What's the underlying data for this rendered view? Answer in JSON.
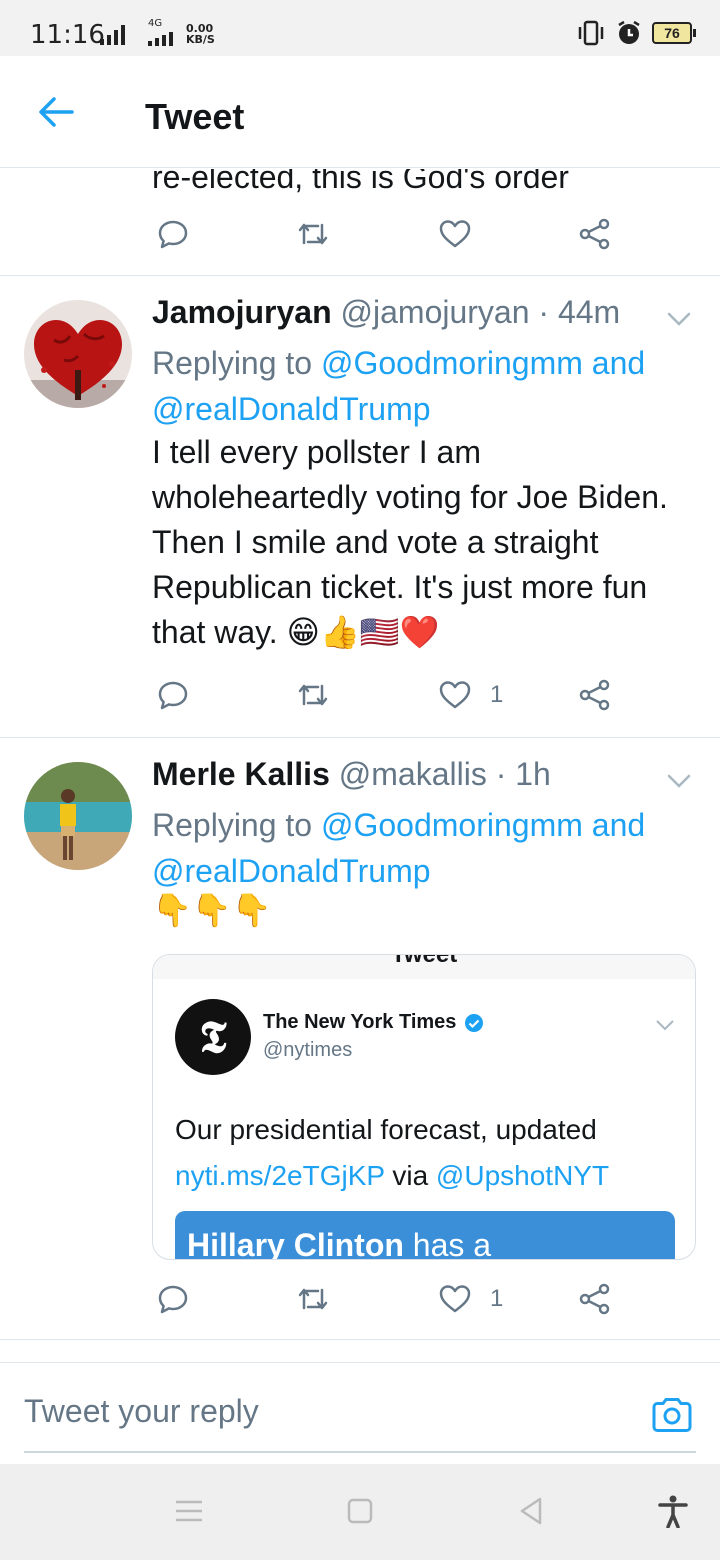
{
  "status_bar": {
    "time": "11:16",
    "network": "4G",
    "speed_value": "0.00",
    "speed_unit": "KB/S",
    "battery": "76"
  },
  "header": {
    "title": "Tweet",
    "back_icon": "arrow-left-icon"
  },
  "previous_tweet": {
    "partial_text": "re-elected, this is God's order",
    "actions": {
      "reply": "",
      "retweet": "",
      "like": "",
      "share": ""
    }
  },
  "tweets": [
    {
      "name": "Jamojuryan",
      "handle": "@jamojuryan",
      "time": "44m",
      "separator": "·",
      "replying_prefix": "Replying to",
      "replying_user1": "@Goodmoringmm",
      "replying_and": "and",
      "replying_user2": "@realDonaldTrump",
      "body": "I tell every pollster I am wholeheartedly voting for Joe Biden. Then I smile and vote a straight Republican ticket. It's just more fun that way. 😁👍🇺🇸❤️",
      "like_count": "1"
    },
    {
      "name": "Merle Kallis",
      "handle": "@makallis",
      "time": "1h",
      "separator": "·",
      "replying_prefix": "Replying to",
      "replying_user1": "@Goodmoringmm",
      "replying_and": "and",
      "replying_user2": "@realDonaldTrump",
      "body": "👇👇👇",
      "like_count": "1",
      "embed": {
        "top_label": "Tweet",
        "account_name": "The New York Times",
        "account_handle": "@nytimes",
        "text_line1": "Our presidential forecast, updated",
        "link": "nyti.ms/2eTGjKP",
        "via": "via",
        "mention": "@UpshotNYT",
        "banner_bold": "Hillary Clinton",
        "banner_rest": " has a"
      }
    }
  ],
  "composer": {
    "placeholder": "Tweet your reply"
  },
  "colors": {
    "accent": "#1da1f2",
    "text": "#14171a",
    "muted": "#657786",
    "divider": "#e1e8ed"
  }
}
